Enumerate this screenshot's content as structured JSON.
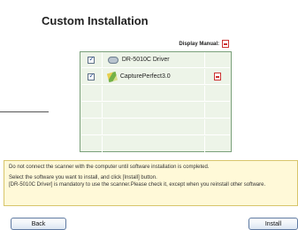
{
  "page": {
    "title": "Custom Installation",
    "display_manual_label": "Display Manual:"
  },
  "software_list": [
    {
      "name": "DR-5010C Driver",
      "checked": true,
      "has_manual": false,
      "icon": "disk-icon"
    },
    {
      "name": "CapturePerfect3.0",
      "checked": true,
      "has_manual": true,
      "icon": "captureperfect-icon"
    }
  ],
  "notes": {
    "line1": "Do not connect the scanner with the computer until software installation is completed.",
    "line2": "Select the software you want to install, and click [Install] button.",
    "line3": "[DR-5010C Driver] is mandatory to use the scanner.Please check it, except when you reinstall other software."
  },
  "buttons": {
    "back": "Back",
    "install": "Install"
  },
  "colors": {
    "panel_bg": "#edf4e8",
    "panel_border": "#7aa07a",
    "note_bg": "#fff9d8",
    "note_border": "#d8c56b",
    "button_border": "#5f7aa2"
  }
}
